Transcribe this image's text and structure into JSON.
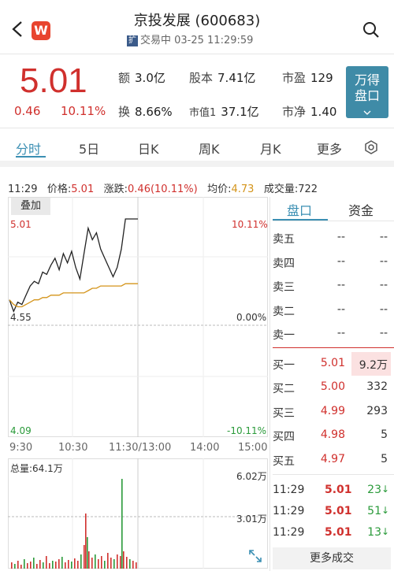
{
  "header": {
    "title": "京投发展 (600683)",
    "status_tag": "扩",
    "status": "交易中 03-25 11:29:59",
    "logo": "W",
    "icons": [
      "back-chevron-icon",
      "search-icon"
    ]
  },
  "quote": {
    "price": "5.01",
    "change": "0.46",
    "change_pct": "10.11%",
    "turnover_amount": {
      "label": "额",
      "value": "3.0亿"
    },
    "turnover_rate": {
      "label": "换",
      "value": "8.66%"
    },
    "share_capital": {
      "label": "股本",
      "value": "7.41亿"
    },
    "market_cap": {
      "label": "市值1",
      "value": "37.1亿"
    },
    "pe": {
      "label": "市盈",
      "value": "129"
    },
    "pb": {
      "label": "市净",
      "value": "1.40"
    },
    "wande_button": "万得\n盘口"
  },
  "tabs": [
    "分时",
    "5日",
    "日K",
    "周K",
    "月K",
    "更多"
  ],
  "info_line": {
    "time": "11:29",
    "price_label": "价格:",
    "price": "5.01",
    "change_label": "涨跌:",
    "change": "0.46(10.11%)",
    "avg_label": "均价:",
    "avg": "4.73",
    "volume_label": "成交量:",
    "volume": "722"
  },
  "chart": {
    "overlay_button": "叠加",
    "price_high": "5.01",
    "price_mid": "4.55",
    "price_low": "4.09",
    "pct_high": "10.11%",
    "pct_mid": "0.00%",
    "pct_low": "-10.11%",
    "time_labels": [
      "9:30",
      "10:30",
      "11:30/13:00",
      "14:00",
      "15:00"
    ],
    "volume_total": "总量:64.1万",
    "volume_max": "6.02万",
    "volume_mid": "3.01万"
  },
  "chart_data": {
    "type": "line",
    "title": "",
    "ylim": [
      4.09,
      5.01
    ],
    "reference_price": 4.55,
    "series": [
      {
        "name": "价格",
        "values": [
          4.66,
          4.61,
          4.65,
          4.64,
          4.68,
          4.72,
          4.74,
          4.73,
          4.78,
          4.77,
          4.81,
          4.84,
          4.79,
          4.86,
          4.82,
          4.87,
          4.8,
          4.75,
          4.86,
          4.97,
          4.92,
          4.95,
          4.88,
          4.84,
          4.8,
          4.76,
          4.8,
          4.88,
          5.01,
          5.01,
          5.01,
          5.01
        ]
      },
      {
        "name": "均价",
        "values": [
          4.66,
          4.64,
          4.63,
          4.63,
          4.64,
          4.65,
          4.66,
          4.66,
          4.67,
          4.67,
          4.68,
          4.68,
          4.68,
          4.69,
          4.69,
          4.69,
          4.69,
          4.69,
          4.69,
          4.7,
          4.71,
          4.71,
          4.72,
          4.72,
          4.72,
          4.72,
          4.72,
          4.72,
          4.73,
          4.73,
          4.73,
          4.73
        ]
      }
    ],
    "volume_ylim": [
      0,
      60200
    ]
  },
  "orderbook": {
    "tabs": [
      "盘口",
      "资金"
    ],
    "asks": [
      {
        "label": "卖五",
        "price": "--",
        "vol": "--"
      },
      {
        "label": "卖四",
        "price": "--",
        "vol": "--"
      },
      {
        "label": "卖三",
        "price": "--",
        "vol": "--"
      },
      {
        "label": "卖二",
        "price": "--",
        "vol": "--"
      },
      {
        "label": "卖一",
        "price": "--",
        "vol": "--"
      }
    ],
    "bids": [
      {
        "label": "买一",
        "price": "5.01",
        "vol": "9.2万"
      },
      {
        "label": "买二",
        "price": "5.00",
        "vol": "332"
      },
      {
        "label": "买三",
        "price": "4.99",
        "vol": "293"
      },
      {
        "label": "买四",
        "price": "4.98",
        "vol": "5"
      },
      {
        "label": "买五",
        "price": "4.97",
        "vol": "5"
      }
    ],
    "trades": [
      {
        "time": "11:29",
        "price": "5.01",
        "vol": "23"
      },
      {
        "time": "11:29",
        "price": "5.01",
        "vol": "51"
      },
      {
        "time": "11:29",
        "price": "5.01",
        "vol": "13"
      }
    ],
    "more_button": "更多成交"
  },
  "colors": {
    "up": "#d0302d",
    "avg": "#d4941a",
    "accent": "#3b8fb3",
    "down": "#2a9a3a"
  }
}
